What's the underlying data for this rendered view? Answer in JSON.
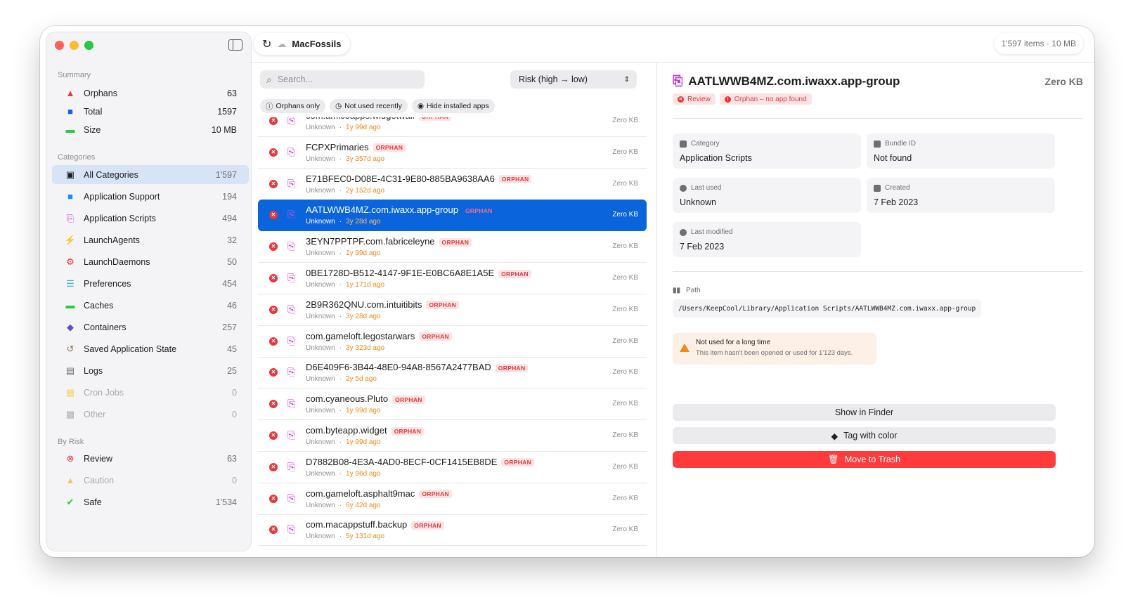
{
  "app": {
    "title": "MacFossils",
    "item_count": "1'597 items · 10 MB"
  },
  "sidebar": {
    "summary_title": "Summary",
    "summary": [
      {
        "label": "Orphans",
        "count": "63",
        "icon": "warning-triangle-icon",
        "color": "#e8363a"
      },
      {
        "label": "Total",
        "count": "1597",
        "icon": "folder-icon",
        "color": "#1a5cff"
      },
      {
        "label": "Size",
        "count": "10 MB",
        "icon": "disk-icon",
        "color": "#28c840"
      }
    ],
    "categories_title": "Categories",
    "categories": [
      {
        "label": "All Categories",
        "count": "1'597",
        "icon": "tray-icon",
        "selected": true
      },
      {
        "label": "Application Support",
        "count": "194",
        "icon": "folder-icon"
      },
      {
        "label": "Application Scripts",
        "count": "494",
        "icon": "script-icon"
      },
      {
        "label": "LaunchAgents",
        "count": "32",
        "icon": "bolt-icon"
      },
      {
        "label": "LaunchDaemons",
        "count": "50",
        "icon": "gears-icon"
      },
      {
        "label": "Preferences",
        "count": "454",
        "icon": "sliders-icon"
      },
      {
        "label": "Caches",
        "count": "46",
        "icon": "disk-icon"
      },
      {
        "label": "Containers",
        "count": "257",
        "icon": "cube-icon"
      },
      {
        "label": "Saved Application State",
        "count": "45",
        "icon": "history-icon"
      },
      {
        "label": "Logs",
        "count": "25",
        "icon": "document-icon"
      },
      {
        "label": "Cron Jobs",
        "count": "0",
        "icon": "calendar-icon",
        "dim": true
      },
      {
        "label": "Other",
        "count": "0",
        "icon": "box-icon",
        "dim": true
      }
    ],
    "risk_title": "By Risk",
    "risk": [
      {
        "label": "Review",
        "count": "63",
        "icon": "x-circle-icon"
      },
      {
        "label": "Caution",
        "count": "0",
        "icon": "warning-triangle-icon",
        "dim": true
      },
      {
        "label": "Safe",
        "count": "1'534",
        "icon": "check-circle-icon"
      }
    ]
  },
  "list": {
    "search_placeholder": "Search...",
    "sort_label": "Risk (high → low)",
    "chips": [
      "Orphans only",
      "Not used recently",
      "Hide installed apps"
    ],
    "orphan_badge": "ORPHAN",
    "rows": [
      {
        "name": "com.amicoapps.widgetwall",
        "owner": "Unknown",
        "age": "1y 99d ago",
        "size": "Zero KB"
      },
      {
        "name": "FCPXPrimaries",
        "owner": "Unknown",
        "age": "3y 357d ago",
        "size": "Zero KB"
      },
      {
        "name": "E71BFEC0-D08E-4C31-9E80-885BA9638AA6",
        "owner": "Unknown",
        "age": "2y 152d ago",
        "size": "Zero KB"
      },
      {
        "name": "AATLWWB4MZ.com.iwaxx.app-group",
        "owner": "Unknown",
        "age": "3y 28d ago",
        "size": "Zero KB",
        "selected": true
      },
      {
        "name": "3EYN7PPTPF.com.fabriceleyne",
        "owner": "Unknown",
        "age": "1y 99d ago",
        "size": "Zero KB"
      },
      {
        "name": "0BE1728D-B512-4147-9F1E-E0BC6A8E1A5E",
        "owner": "Unknown",
        "age": "1y 171d ago",
        "size": "Zero KB"
      },
      {
        "name": "2B9R362QNU.com.intuitibits",
        "owner": "Unknown",
        "age": "3y 28d ago",
        "size": "Zero KB"
      },
      {
        "name": "com.gameloft.legostarwars",
        "owner": "Unknown",
        "age": "3y 323d ago",
        "size": "Zero KB"
      },
      {
        "name": "D6E409F6-3B44-48E0-94A8-8567A2477BAD",
        "owner": "Unknown",
        "age": "2y 5d ago",
        "size": "Zero KB"
      },
      {
        "name": "com.cyaneous.Pluto",
        "owner": "Unknown",
        "age": "1y 99d ago",
        "size": "Zero KB"
      },
      {
        "name": "com.byteapp.widget",
        "owner": "Unknown",
        "age": "1y 99d ago",
        "size": "Zero KB"
      },
      {
        "name": "D7882B08-4E3A-4AD0-8ECF-0CF1415EB8DE",
        "owner": "Unknown",
        "age": "1y 96d ago",
        "size": "Zero KB"
      },
      {
        "name": "com.gameloft.asphalt9mac",
        "owner": "Unknown",
        "age": "6y 42d ago",
        "size": "Zero KB"
      },
      {
        "name": "com.macappstuff.backup",
        "owner": "Unknown",
        "age": "5y 131d ago",
        "size": "Zero KB"
      }
    ]
  },
  "detail": {
    "title": "AATLWWB4MZ.com.iwaxx.app-group",
    "size": "Zero KB",
    "tag_review": "Review",
    "tag_orphan": "Orphan – no app found",
    "category_label": "Category",
    "category_value": "Application Scripts",
    "bundle_label": "Bundle ID",
    "bundle_value": "Not found",
    "last_used_label": "Last used",
    "last_used_value": "Unknown",
    "created_label": "Created",
    "created_value": "7 Feb 2023",
    "modified_label": "Last modified",
    "modified_value": "7 Feb 2023",
    "path_label": "Path",
    "path_value": "/Users/KeepCool/Library/Application Scripts/AATLWWB4MZ.com.iwaxx.app-group",
    "warn_title": "Not used for a long time",
    "warn_text": "This item hasn't been opened or used for 1'123 days.",
    "show_in_finder": "Show in Finder",
    "tag_with_color": "Tag with color",
    "move_to_trash": "Move to Trash"
  }
}
